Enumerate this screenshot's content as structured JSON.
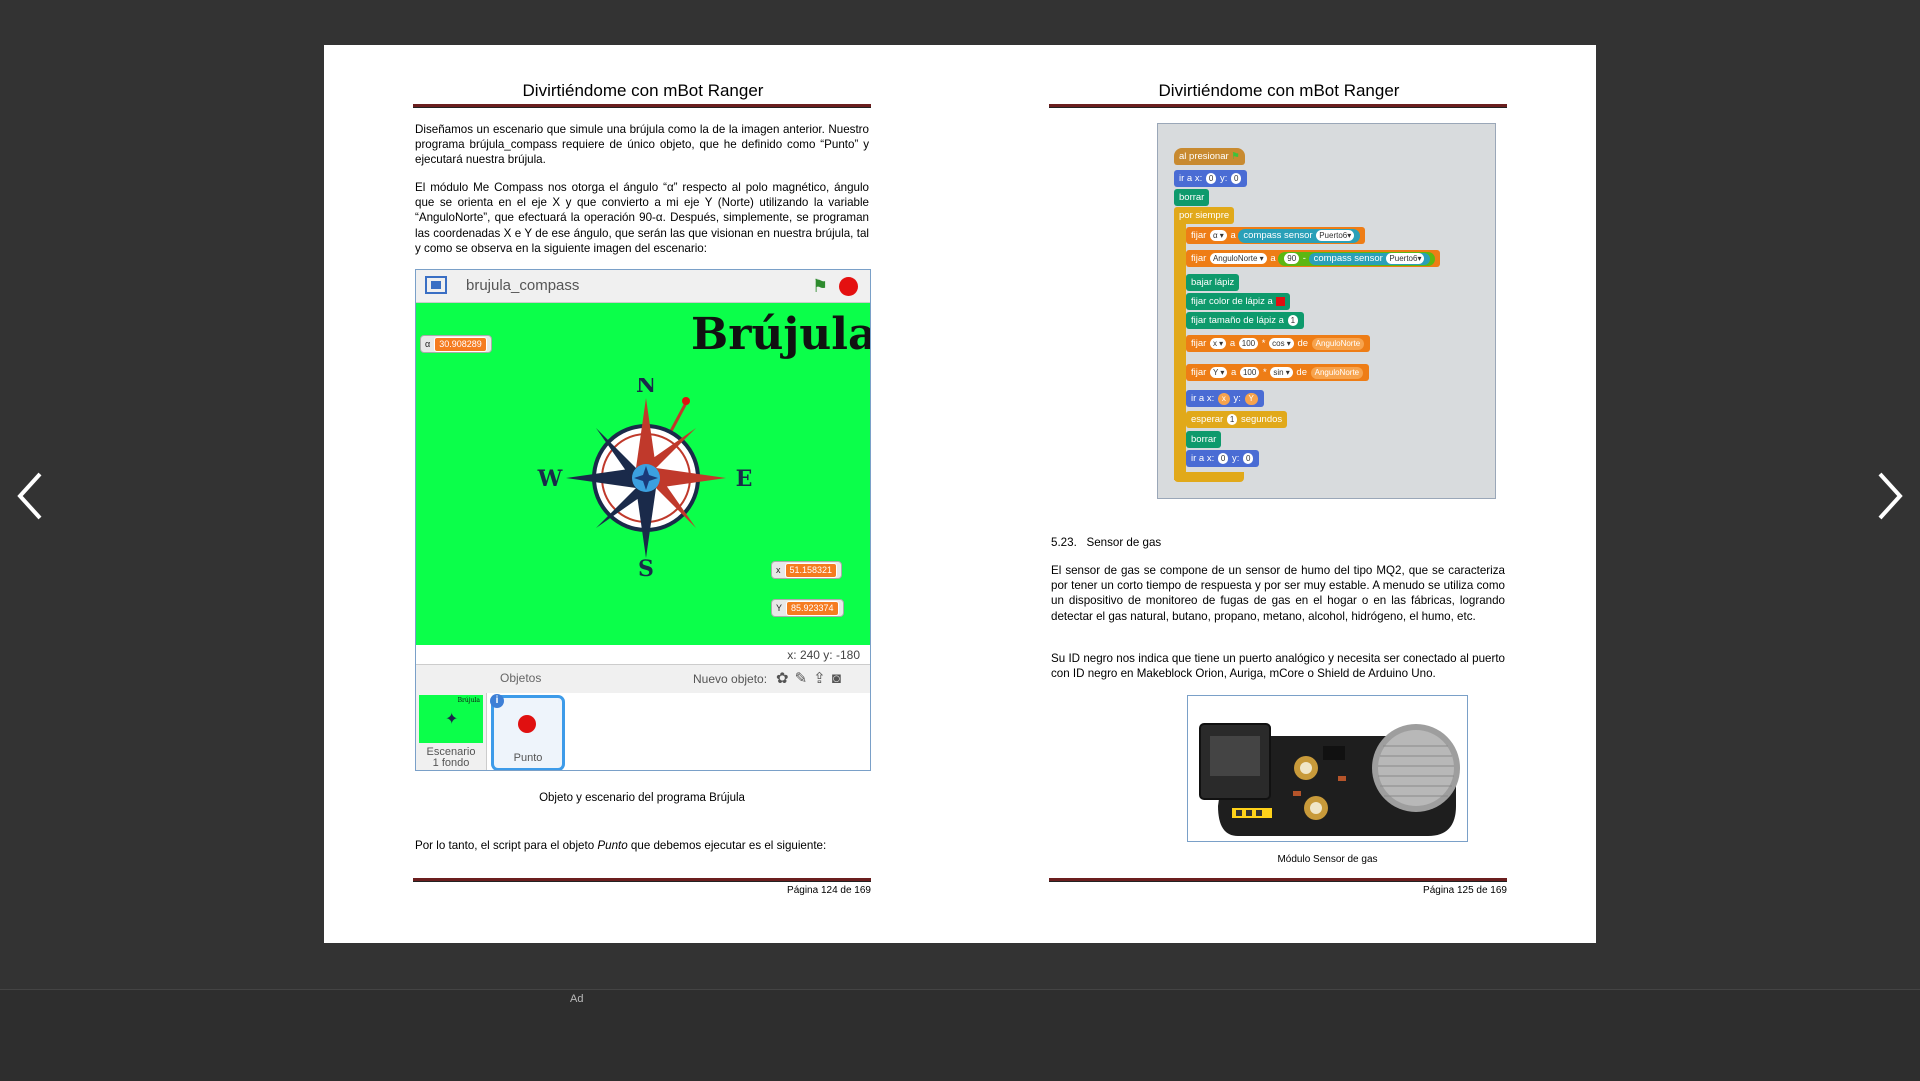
{
  "viewer": {
    "ad_label": "Ad"
  },
  "left_page": {
    "header": "Divirtiéndome con mBot Ranger",
    "para1": "Diseñamos un escenario que simule una brújula como la de la imagen anterior. Nuestro programa brújula_compass requiere de único objeto, que he definido como “Punto” y ejecutará nuestra brújula.",
    "para2": "El módulo Me Compass nos otorga el ángulo “α” respecto al polo magnético, ángulo que se orienta en el eje X y que convierto a mi eje Y (Norte) utilizando la variable “AnguloNorte”, que efectuará la operación 90-α. Después, simplemente, se programan las coordenadas X e Y de ese ángulo, que serán las que visionan en nuestra brújula, tal y como se observa en la siguiente imagen del escenario:",
    "scratch": {
      "project_name": "brujula_compass",
      "stage_title": "Brújula",
      "alpha_label": "α",
      "alpha_value": "30.908289",
      "x_label": "x",
      "x_value": "51.158321",
      "y_label": "Y",
      "y_value": "85.923374",
      "compass_n": "N",
      "compass_s": "S",
      "compass_e": "E",
      "compass_w": "W",
      "coords_text": "x: 240  y: -180",
      "objetos": "Objetos",
      "nuevo_objeto": "Nuevo objeto:",
      "scene_label": "Escenario\n1 fondo",
      "sprite_label": "Punto",
      "scene_thumb_title": "Brújula"
    },
    "caption": "Objeto y escenario del programa Brújula",
    "para3_a": "Por lo tanto, el script para el objeto ",
    "para3_em": "Punto",
    "para3_b": " que debemos ejecutar es el siguiente:",
    "footer": "Página 124 de 169"
  },
  "right_page": {
    "header": "Divirtiéndome con mBot Ranger",
    "code_blocks": {
      "b1": "al presionar",
      "b2a": "ir a x:",
      "b2b": "0",
      "b2c": "y:",
      "b2d": "0",
      "b3": "borrar",
      "b4": "por siempre",
      "b5a": "fijar",
      "b5b": "α ▾",
      "b5c": "a",
      "b5d": "compass sensor",
      "b5e": "Puerto6▾",
      "b6a": "fijar",
      "b6b": "AnguloNorte ▾",
      "b6c": "a",
      "b6d": "90",
      "b6e": "-",
      "b6f": "compass sensor",
      "b6g": "Puerto6▾",
      "b7": "bajar lápiz",
      "b8": "fijar color de lápiz a",
      "b9a": "fijar tamaño de lápiz a",
      "b9b": "1",
      "b10a": "fijar",
      "b10b": "x ▾",
      "b10c": "a",
      "b10d": "100",
      "b10e": "*",
      "b10f": "cos ▾",
      "b10g": "de",
      "b10h": "AnguloNorte",
      "b11a": "fijar",
      "b11b": "Y ▾",
      "b11c": "a",
      "b11d": "100",
      "b11e": "*",
      "b11f": "sin ▾",
      "b11g": "de",
      "b11h": "AnguloNorte",
      "b12a": "ir a x:",
      "b12b": "x",
      "b12c": "y:",
      "b12d": "Y",
      "b13a": "esperar",
      "b13b": "1",
      "b13c": "segundos",
      "b14": "borrar",
      "b15a": "ir a x:",
      "b15b": "0",
      "b15c": "y:",
      "b15d": "0"
    },
    "section_number": "5.23.",
    "section_title": "Sensor de gas",
    "para1": "El sensor de gas se compone de un sensor de humo del tipo MQ2, que se caracteriza por tener un corto tiempo de respuesta y por ser muy estable. A menudo se utiliza como un dispositivo de monitoreo de fugas de gas en el hogar o en las fábricas, logrando detectar el gas natural, butano, propano, metano, alcohol, hidrógeno, el humo, etc.",
    "para2": "Su ID negro nos indica que tiene un puerto analógico y necesita ser conectado al puerto con ID negro en Makeblock Orion, Auriga, mCore o Shield de Arduino Uno.",
    "caption": "Módulo Sensor de gas",
    "footer": "Página 125 de 169"
  }
}
